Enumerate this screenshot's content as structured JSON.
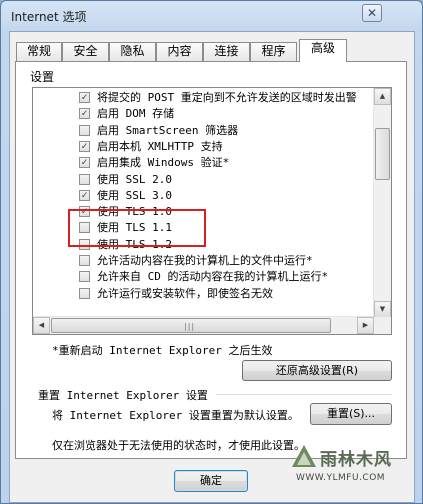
{
  "window": {
    "title": "Internet 选项",
    "close_label": "✕"
  },
  "tabs": [
    {
      "label": "常规",
      "active": false
    },
    {
      "label": "安全",
      "active": false
    },
    {
      "label": "隐私",
      "active": false
    },
    {
      "label": "内容",
      "active": false
    },
    {
      "label": "连接",
      "active": false
    },
    {
      "label": "程序",
      "active": false
    },
    {
      "label": "高级",
      "active": true
    }
  ],
  "settings": {
    "group_label": "设置",
    "items": [
      {
        "label": "将提交的 POST 重定向到不允许发送的区域时发出警",
        "checked": true
      },
      {
        "label": "启用 DOM 存储",
        "checked": true
      },
      {
        "label": "启用 SmartScreen 筛选器",
        "checked": false
      },
      {
        "label": "启用本机 XMLHTTP 支持",
        "checked": true
      },
      {
        "label": "启用集成 Windows 验证*",
        "checked": true
      },
      {
        "label": "使用 SSL 2.0",
        "checked": false
      },
      {
        "label": "使用 SSL 3.0",
        "checked": true,
        "highlighted": true
      },
      {
        "label": "使用 TLS 1.0",
        "checked": true,
        "highlighted": true
      },
      {
        "label": "使用 TLS 1.1",
        "checked": false
      },
      {
        "label": "使用 TLS 1.2",
        "checked": false
      },
      {
        "label": "允许活动内容在我的计算机上的文件中运行*",
        "checked": false
      },
      {
        "label": "允许来自 CD 的活动内容在我的计算机上运行*",
        "checked": false
      },
      {
        "label": "允许运行或安装软件，即使签名无效",
        "checked": false
      }
    ],
    "scroll_position": 0.3
  },
  "restart_note": "*重新启动 Internet Explorer 之后生效",
  "restore_advanced_button": "还原高级设置(R)",
  "reset_section": {
    "title": "重置 Internet Explorer 设置",
    "description": "将 Internet Explorer 设置重置为默认设置。",
    "reset_button": "重置(S)...",
    "note": "仅在浏览器处于无法使用的状态时，才使用此设置。"
  },
  "footer": {
    "ok_button": "确定"
  },
  "watermark": {
    "text": "雨林木风",
    "url": "WWW.YLMFU.COM"
  }
}
